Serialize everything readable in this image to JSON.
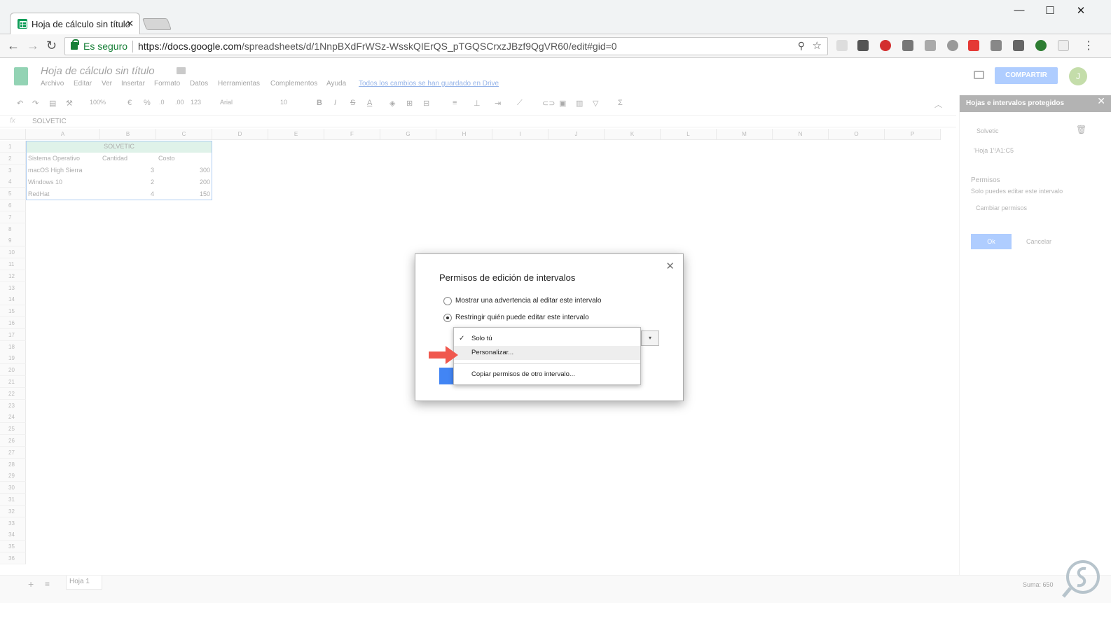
{
  "browser": {
    "tab_title": "Hoja de cálculo sin título",
    "tab_close": "✕",
    "win_min": "—",
    "win_max": "☐",
    "win_close": "✕",
    "secure_label": "Es seguro",
    "url_host": "https://docs.google.com",
    "url_path": "/spreadsheets/d/1NnpBXdFrWSz-WsskQIErQS_pTGQSCrxzJBzf9QgVR60/edit#gid=0",
    "back": "←",
    "forward": "→",
    "reload": "↻",
    "zoom_icon": "⚲",
    "star_icon": "☆",
    "menu_icon": "⋮"
  },
  "doc": {
    "title": "Hoja de cálculo sin título",
    "menus": [
      "Archivo",
      "Editar",
      "Ver",
      "Insertar",
      "Formato",
      "Datos",
      "Herramientas",
      "Complementos",
      "Ayuda"
    ],
    "saved_status": "Todos los cambios se han guardado en Drive",
    "share_label": "COMPARTIR",
    "avatar_letter": "J"
  },
  "toolbar": {
    "zoom": "100%",
    "currency": "€",
    "percent": "%",
    "dec_less": ".0",
    "dec_more": ".00",
    "format_123": "123",
    "font": "Arial",
    "size": "10",
    "bold": "B",
    "italic": "I",
    "strike": "S",
    "textcolor": "A",
    "sum": "Σ"
  },
  "formula_bar": {
    "fx": "fx",
    "value": "SOLVETIC"
  },
  "columns": [
    "A",
    "B",
    "C",
    "D",
    "E",
    "F",
    "G",
    "H",
    "I",
    "J",
    "K",
    "L",
    "M",
    "N",
    "O",
    "P"
  ],
  "rows": [
    "1",
    "2",
    "3",
    "4",
    "5",
    "6",
    "7",
    "8",
    "9",
    "10",
    "11",
    "12",
    "13",
    "14",
    "15",
    "16",
    "17",
    "18",
    "19",
    "20",
    "21",
    "22",
    "23",
    "24",
    "25",
    "26",
    "27",
    "28",
    "29",
    "30",
    "31",
    "32",
    "33",
    "34",
    "35",
    "36"
  ],
  "cells": {
    "title": "SOLVETIC",
    "header_os": "Sistema Operativo",
    "header_qty": "Cantidad",
    "header_cost": "Costo",
    "r3_os": "macOS High Sierra",
    "r3_qty": "3",
    "r3_cost": "300",
    "r4_os": "Windows 10",
    "r4_qty": "2",
    "r4_cost": "200",
    "r5_os": "RedHat",
    "r5_qty": "4",
    "r5_cost": "150"
  },
  "side_panel": {
    "header": "Hojas e intervalos protegidos",
    "close": "✕",
    "description": "Solvetic",
    "range": "'Hoja 1'!A1:C5",
    "permissions_title": "Permisos",
    "permissions_note": "Solo puedes editar este intervalo",
    "change_permissions": "Cambiar permisos",
    "ok": "Ok",
    "cancel": "Cancelar"
  },
  "bottom": {
    "add": "+",
    "list": "≡",
    "sheet_tab": "Hoja 1",
    "sum": "Suma: 650"
  },
  "dialog": {
    "title": "Permisos de edición de intervalos",
    "close": "✕",
    "option_warning": "Mostrar una advertencia al editar este intervalo",
    "option_restrict": "Restringir quién puede editar este intervalo",
    "dropdown_arrow": "▾"
  },
  "dropdown": {
    "check": "✓",
    "opt_only_you": "Solo tú",
    "opt_customize": "Personalizar...",
    "opt_copy": "Copiar permisos de otro intervalo..."
  },
  "colors": {
    "accent": "#4d90fe",
    "sheets_green": "#0f9d58",
    "arrow": "#f0584e",
    "title_fill": "#b7e1cd"
  }
}
